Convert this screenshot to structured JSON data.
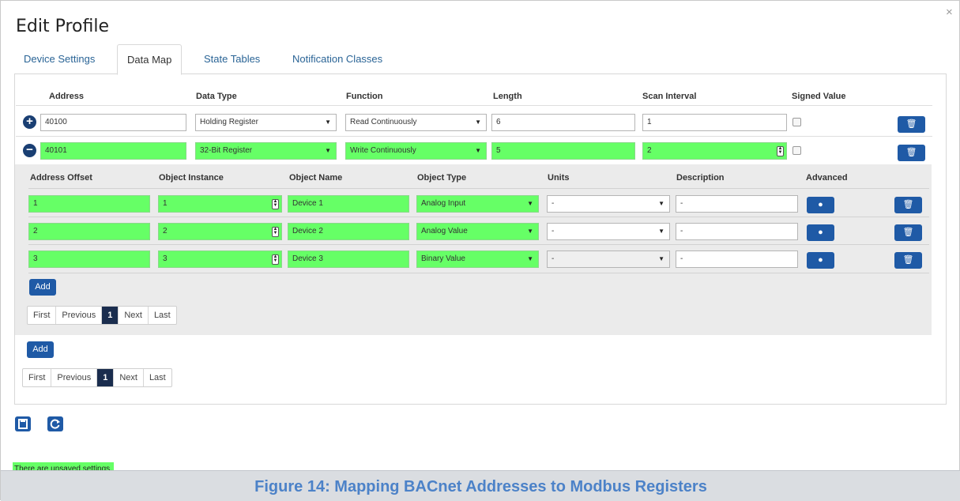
{
  "window": {
    "title": "Edit Profile",
    "close_glyph": "×"
  },
  "tabs": [
    "Device Settings",
    "Data Map",
    "State Tables",
    "Notification Classes"
  ],
  "active_tab": "Data Map",
  "register_table": {
    "headers": [
      "Address",
      "Data Type",
      "Function",
      "Length",
      "Scan Interval",
      "Signed Value"
    ],
    "rows": [
      {
        "row_icon": "plus-circle-icon",
        "address": "40100",
        "data_type": "Holding Register",
        "function": "Read Continuously",
        "length": "6",
        "scan_interval": "1",
        "signed": false,
        "modified": false
      },
      {
        "row_icon": "minus-circle-icon",
        "address": "40101",
        "data_type": "32-Bit Register",
        "function": "Write Continuously",
        "length": "5",
        "scan_interval": "2",
        "signed": false,
        "modified": true
      }
    ]
  },
  "object_table": {
    "headers": [
      "Address Offset",
      "Object Instance",
      "Object Name",
      "Object Type",
      "Units",
      "Description",
      "Advanced"
    ],
    "rows": [
      {
        "offset": "1",
        "instance": "1",
        "name": "Device 1",
        "type": "Analog Input",
        "units": "-",
        "description": "-"
      },
      {
        "offset": "2",
        "instance": "2",
        "name": "Device 2",
        "type": "Analog Value",
        "units": "-",
        "description": "-"
      },
      {
        "offset": "3",
        "instance": "3",
        "name": "Device 3",
        "type": "Binary Value",
        "units": "-",
        "description": "-"
      }
    ]
  },
  "add_label": "Add",
  "pager": {
    "first": "First",
    "previous": "Previous",
    "current": "1",
    "next": "Next",
    "last": "Last"
  },
  "footer": {
    "save_icon": "save-icon",
    "reload_icon": "refresh-icon"
  },
  "status_text": "There are unsaved settings.",
  "caption": "Figure 14: Mapping BACnet Addresses to Modbus Registers",
  "colors": {
    "modified": "#66ff66",
    "accent": "#1f5aa6",
    "caption": "#4c82c8"
  }
}
